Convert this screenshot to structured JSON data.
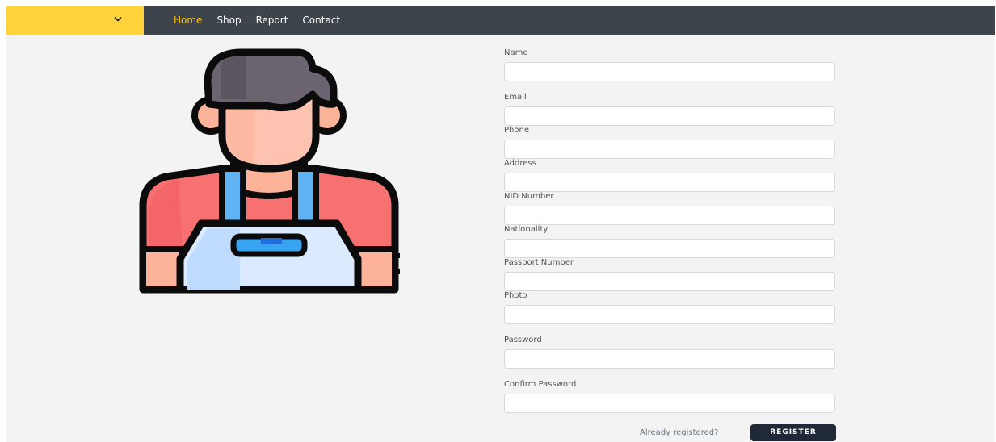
{
  "header": {
    "dropdown_icon": "chevron-down-icon",
    "nav": [
      {
        "label": "Home",
        "active": true
      },
      {
        "label": "Shop"
      },
      {
        "label": "Report"
      },
      {
        "label": "Contact"
      }
    ],
    "brand_color": "#ffd43a",
    "active_color": "#ffc107"
  },
  "illustration": {
    "icon": "shopkeeper-avatar-icon"
  },
  "form": {
    "fields": [
      {
        "label": "Name",
        "value": ""
      },
      {
        "label": "Email",
        "value": ""
      },
      {
        "label": "Phone",
        "value": ""
      },
      {
        "label": "Address",
        "value": ""
      },
      {
        "label": "NID Number",
        "value": ""
      },
      {
        "label": "Nationality",
        "value": ""
      },
      {
        "label": "Passport Number",
        "value": ""
      },
      {
        "label": "Photo",
        "value": ""
      },
      {
        "label": "Password",
        "value": ""
      },
      {
        "label": "Confirm Password",
        "value": ""
      }
    ],
    "login_link": "Already registered?",
    "submit_label": "REGISTER"
  }
}
